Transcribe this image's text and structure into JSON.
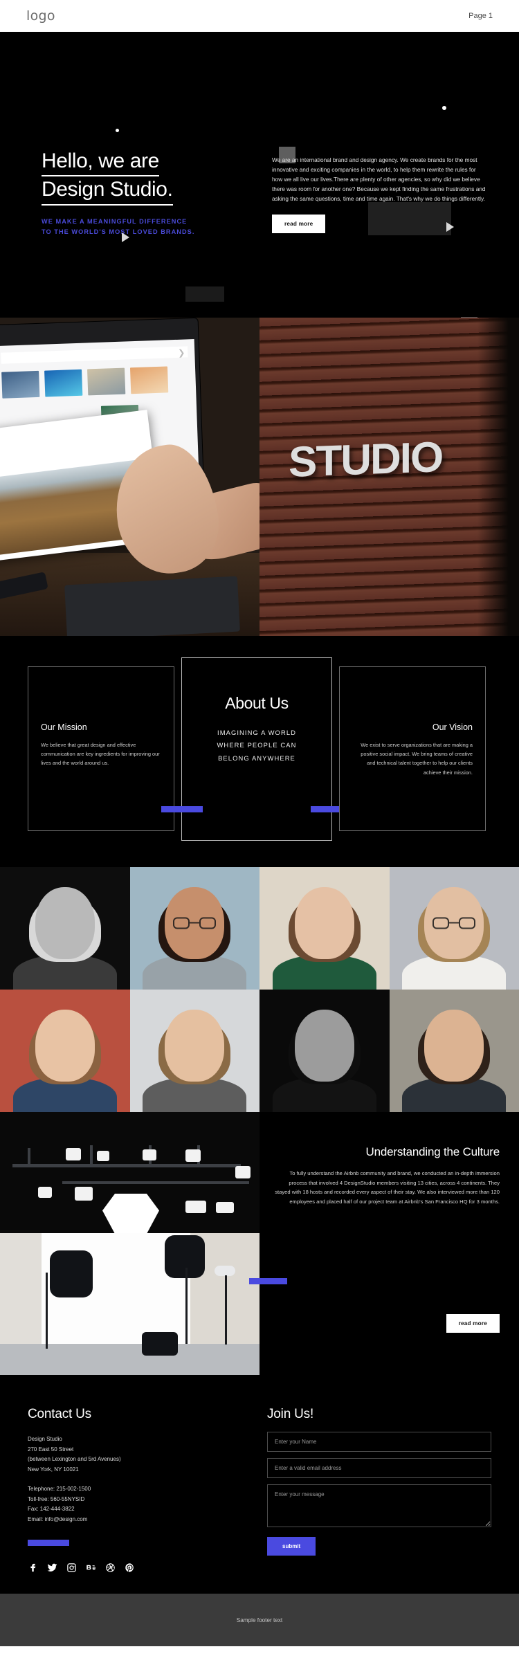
{
  "topbar": {
    "logo": "logo",
    "page_label": "Page 1"
  },
  "hero": {
    "heading_line1": "Hello, we are",
    "heading_line2": "Design Studio.",
    "tagline_line1": "WE MAKE A MEANINGFUL DIFFERENCE",
    "tagline_line2": "TO THE WORLD'S MOST LOVED BRANDS.",
    "paragraph": "We are an international brand and design agency. We create brands for the most innovative and exciting companies in the world, to help them rewrite the rules for how we all live our lives.There are plenty of other agencies, so why did we believe there was room for another one? Because we kept finding the same frustrations and asking the same questions, time and time again. That's why we do things differently.",
    "read_more": "read more"
  },
  "showcase": {
    "studio_sign_text": "STUDIO",
    "left_image_alt": "designer-holding-photo-print-at-desk",
    "right_image_alt": "studio-sign-on-wood-wall"
  },
  "about": {
    "mission": {
      "title": "Our Mission",
      "text": "We believe that great design and effective communication are key ingredients for improving our lives and the world around us."
    },
    "center": {
      "title": "About Us",
      "sub_line1": "IMAGINING A WORLD",
      "sub_line2": "WHERE PEOPLE CAN",
      "sub_line3": "BELONG ANYWHERE"
    },
    "vision": {
      "title": "Our Vision",
      "text": "We exist to serve organizations that are making a positive social impact. We bring teams of creative and technical talent together to help our clients achieve their mission."
    }
  },
  "team": {
    "members": [
      {
        "alt": "smiling-young-man-bw-portrait",
        "skin": "#b9b9b9",
        "hair": "#d8d8d8",
        "bg": "#0d0d0d",
        "shirt": "#3a3a3a",
        "glasses": false
      },
      {
        "alt": "woman-with-glasses-portrait",
        "skin": "#c68f6c",
        "hair": "#241610",
        "bg": "#9fb7c4",
        "shirt": "#98a2a8",
        "glasses": true
      },
      {
        "alt": "laughing-woman-curly-hair",
        "skin": "#e5c1a5",
        "hair": "#6b4a32",
        "bg": "#ded6c8",
        "shirt": "#1f5a3c",
        "glasses": false
      },
      {
        "alt": "bearded-man-with-glasses",
        "skin": "#e2bfa2",
        "hair": "#a58455",
        "bg": "#b9bcc2",
        "shirt": "#f0efec",
        "glasses": true
      },
      {
        "alt": "woman-red-background-portrait",
        "skin": "#e8c3a4",
        "hair": "#8b6240",
        "bg": "#b9503f",
        "shirt": "#2e4666",
        "glasses": false
      },
      {
        "alt": "bearded-smiling-man",
        "skin": "#e5c0a0",
        "hair": "#8a6a45",
        "bg": "#d6d8da",
        "shirt": "#5d5d5d",
        "glasses": false
      },
      {
        "alt": "woman-bw-dramatic-portrait",
        "skin": "#9c9c9c",
        "hair": "#0e0e0e",
        "bg": "#0a0a0a",
        "shirt": "#131313",
        "glasses": false
      },
      {
        "alt": "young-man-wooden-wall",
        "skin": "#dcb392",
        "hair": "#2e2119",
        "bg": "#9a968c",
        "shirt": "#2b3138",
        "glasses": false
      }
    ]
  },
  "culture": {
    "title": "Understanding the Culture",
    "text": "To fully understand the Airbnb community and brand, we conducted an in-depth immersion process that involved 4 DesignStudio members visiting 13 cities, across 4 continents. They stayed with 18 hosts and recorded every aspect of their stay. We also interviewed more than 120 employees and placed half of our project team at Airbnb's San Francisco HQ for 3 months.",
    "read_more": "read more",
    "image_alt": "photo-studio-with-lighting-equipment"
  },
  "contact": {
    "title": "Contact Us",
    "address_line1": "Design Studio",
    "address_line2": "270 East 50 Street",
    "address_line3": "(between Lexington and 5rd Avenues)",
    "address_line4": "New York, NY 10021",
    "tel_line1": "Telephone: 215-002-1500",
    "tel_line2": "Toll-free: 560-55NYSID",
    "tel_line3": "Fax: 142-444-3822",
    "tel_line4": "Email: info@design.com",
    "socials": [
      "facebook-icon",
      "twitter-icon",
      "instagram-icon",
      "behance-icon",
      "dribbble-icon",
      "pinterest-icon"
    ]
  },
  "join": {
    "title": "Join Us!",
    "name_placeholder": "Enter your Name",
    "email_placeholder": "Enter a valid email address",
    "message_placeholder": "Enter your message",
    "submit_label": "submit",
    "name_value": "",
    "email_value": "",
    "message_value": ""
  },
  "footer": {
    "text": "Sample footer text"
  },
  "colors": {
    "accent_blue": "#4a4ae0",
    "page_bg": "#000000",
    "footer_bg": "#3b3b3b"
  }
}
